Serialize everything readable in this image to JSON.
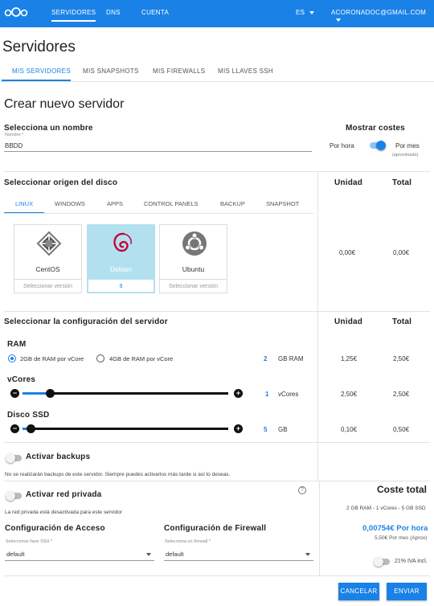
{
  "topbar": {
    "nav": [
      "SERVIDORES",
      "DNS",
      "CUENTA"
    ],
    "language": "ES",
    "account": "ACORONADOC@GMAIL.COM"
  },
  "page_title": "Servidores",
  "main_tabs": [
    "MIS SERVIDORES",
    "MIS SNAPSHOTS",
    "MIS FIREWALLS",
    "MIS LLAVES SSH"
  ],
  "create": {
    "title": "Crear nuevo servidor",
    "name_section": "Selecciona un nombre",
    "name_label": "Nombre *",
    "name_value": "BBDD",
    "costs_title": "Mostrar costes",
    "por_hora": "Por hora",
    "por_mes": "Por mes",
    "aproximado": "(aproximado)"
  },
  "disk": {
    "title": "Seleccionar origen del disco",
    "tabs": [
      "LINUX",
      "WINDOWS",
      "APPS",
      "CONTROL PANELS",
      "BACKUP",
      "SNAPSHOT"
    ],
    "cards": [
      {
        "name": "CentOS",
        "version": "Seleccionar versión"
      },
      {
        "name": "Debian",
        "version": "9"
      },
      {
        "name": "Ubuntu",
        "version": "Seleccionar versión"
      }
    ],
    "unidad": "Unidad",
    "total": "Total",
    "unit_cost": "0,00€",
    "total_cost": "0,00€"
  },
  "config": {
    "title": "Seleccionar la configuración del servidor",
    "unidad": "Unidad",
    "total": "Total",
    "ram_label": "RAM",
    "ram_option_1": "2GB de RAM por vCore",
    "ram_option_2": "4GB de RAM por vCore",
    "ram_value": "2",
    "ram_unit": "GB RAM",
    "ram_unit_cost": "1,25€",
    "ram_total": "2,50€",
    "vcores_label": "vCores",
    "vcores_value": "1",
    "vcores_unit": "vCores",
    "vcores_unit_cost": "2,50€",
    "vcores_total": "2,50€",
    "vcores_level": 0.12,
    "ssd_label": "Disco SSD",
    "ssd_value": "5",
    "ssd_unit": "GB",
    "ssd_unit_cost": "0,10€",
    "ssd_total": "0,50€",
    "ssd_level": 0.02
  },
  "backups": {
    "label": "Activar backups",
    "note": "No se realizarán backups de este servidor. Siempre puedes activarlos más tarde si así lo deseas."
  },
  "private_net": {
    "label": "Activar red privada",
    "note": "La red privada está desactivada para este servidor"
  },
  "access": {
    "title": "Configuración de Acceso",
    "field_label": "Seleccionar llave SSH *",
    "value": "default"
  },
  "firewall": {
    "title": "Configuración de Firewall",
    "field_label": "Selecciona un firewall *",
    "value": "default"
  },
  "summary": {
    "title": "Coste total",
    "spec": "2 GB RAM - 1 vCores - 5 GB SSD",
    "hourly": "0,00754€ Por hora",
    "monthly": "5,50€ Por mes (Aprox)",
    "iva": "21% IVA incl."
  },
  "buttons": {
    "cancel": "CANCELAR",
    "send": "ENVIAR"
  },
  "colors": {
    "primary": "#1a82e6",
    "selected_card": "#b3e0ef"
  }
}
